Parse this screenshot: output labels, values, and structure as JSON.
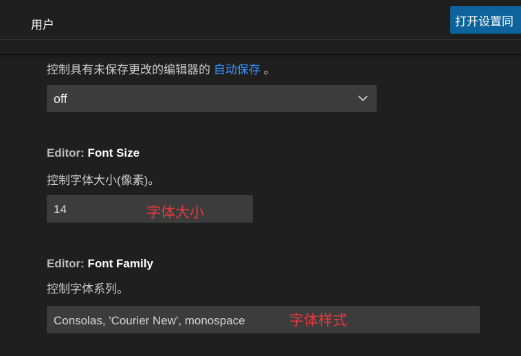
{
  "header": {
    "tab_label": "用户",
    "open_settings_button": "打开设置同"
  },
  "auto_save": {
    "description_prefix": "控制具有未保存更改的编辑器的",
    "description_link": "自动保存",
    "description_suffix": "。",
    "selected_value": "off"
  },
  "font_size": {
    "category": "Editor: ",
    "name": "Font Size",
    "description": "控制字体大小(像素)。",
    "value": "14",
    "annotation": "字体大小"
  },
  "font_family": {
    "category": "Editor: ",
    "name": "Font Family",
    "description": "控制字体系列。",
    "value": "Consolas, 'Courier New', monospace",
    "annotation": "字体样式"
  }
}
